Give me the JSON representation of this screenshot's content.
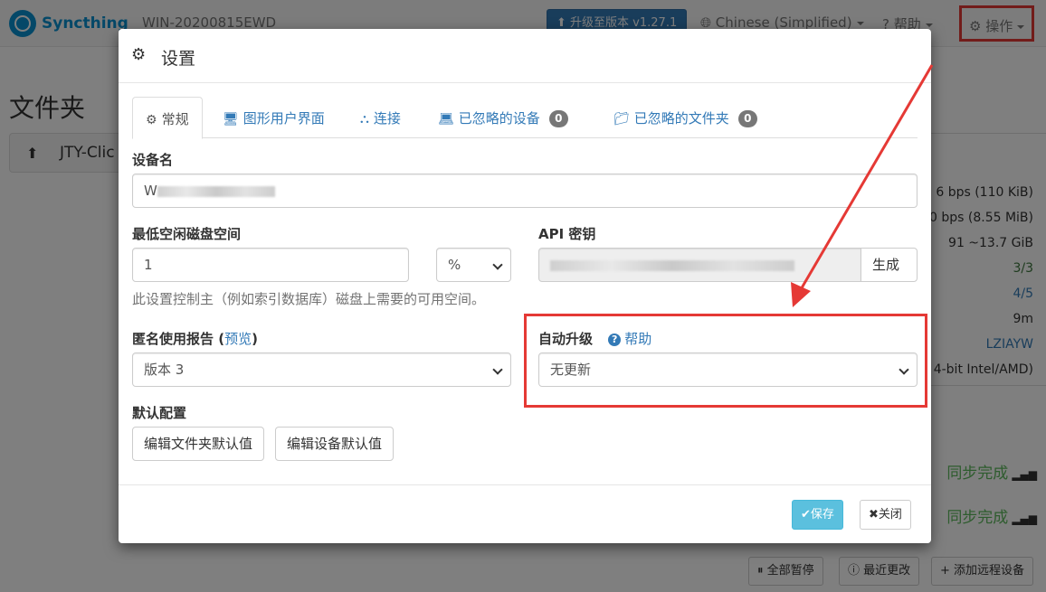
{
  "navbar": {
    "brand": "Syncthing",
    "device": "WIN-20200815EWD",
    "upgrade_button": "升级至版本 v1.27.1",
    "language": "Chinese (Simplified)",
    "help": "帮助",
    "actions": "操作"
  },
  "background": {
    "heading": "文件夹",
    "folder_label": "JTY-Clic",
    "stats": [
      "6 bps (110 KiB)",
      "0 bps (8.55 MiB)",
      "91  ~13.7 GiB",
      "3/3",
      "4/5",
      "9m",
      "LZIAYW",
      "4-bit Intel/AMD)"
    ],
    "sync_status": [
      "同步完成",
      "同步完成"
    ],
    "bottom_buttons": [
      "全部暂停",
      "最近更改",
      "添加远程设备"
    ]
  },
  "modal": {
    "title": "设置",
    "tabs": [
      {
        "label": "常规",
        "icon": "gear-icon"
      },
      {
        "label": "图形用户界面",
        "icon": "monitor-icon"
      },
      {
        "label": "连接",
        "icon": "sitemap-icon"
      },
      {
        "label": "已忽略的设备",
        "icon": "laptop-icon",
        "badge": "0"
      },
      {
        "label": "已忽略的文件夹",
        "icon": "folder-icon",
        "badge": "0"
      }
    ],
    "device_name": {
      "label": "设备名",
      "value_prefix": "W"
    },
    "min_disk": {
      "label": "最低空闲磁盘空间",
      "value": "1",
      "unit": "%",
      "help": "此设置控制主（例如索引数据库）磁盘上需要的可用空间。"
    },
    "api_key": {
      "label": "API 密钥",
      "button": "生成"
    },
    "usage_report": {
      "label": "匿名使用报告",
      "preview_link": "预览",
      "value": "版本 3"
    },
    "auto_upgrade": {
      "label": "自动升级",
      "help_link": "帮助",
      "value": "无更新"
    },
    "default_config": {
      "label": "默认配置",
      "folder_button": "编辑文件夹默认值",
      "device_button": "编辑设备默认值"
    },
    "footer": {
      "save": "保存",
      "close": "关闭"
    }
  },
  "colors": {
    "highlight": "#e53935",
    "link": "#337ab7",
    "save": "#5bc0de",
    "brand": "#0891d1"
  }
}
